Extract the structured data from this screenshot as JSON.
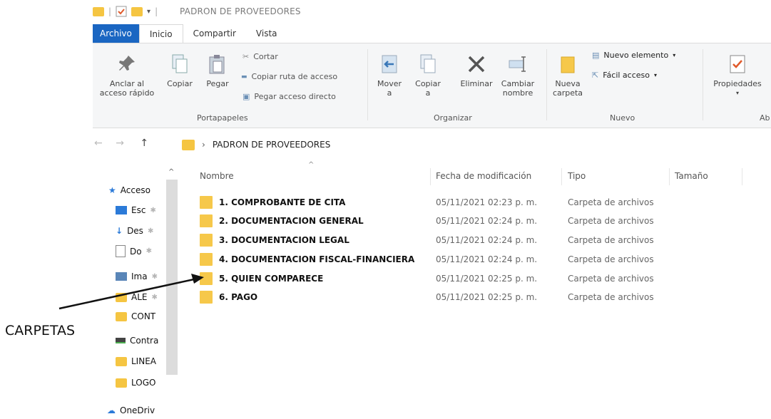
{
  "window": {
    "title": "PADRON DE PROVEEDORES"
  },
  "ribbon_tabs": [
    "Archivo",
    "Inicio",
    "Compartir",
    "Vista"
  ],
  "ribbon": {
    "anclar": "Anclar al\nacceso rápido",
    "copiar": "Copiar",
    "pegar": "Pegar",
    "cortar": "Cortar",
    "copiar_ruta": "Copiar ruta de acceso",
    "pegar_acceso": "Pegar acceso directo",
    "portapapeles": "Portapapeles",
    "mover": "Mover\na",
    "copiar_a": "Copiar\na",
    "eliminar": "Eliminar",
    "cambiar_nombre": "Cambiar\nnombre",
    "organizar": "Organizar",
    "nueva_carpeta": "Nueva\ncarpeta",
    "nuevo_elemento": "Nuevo elemento",
    "facil_acceso": "Fácil acceso",
    "nuevo": "Nuevo",
    "propiedades": "Propiedades",
    "abrir_partial": "Ab"
  },
  "address": {
    "path": "PADRON DE PROVEEDORES"
  },
  "columns": {
    "nombre": "Nombre",
    "fecha": "Fecha de modificación",
    "tipo": "Tipo",
    "tamano": "Tamaño"
  },
  "files": [
    {
      "name": "1. COMPROBANTE DE CITA",
      "date": "05/11/2021 02:23 p. m.",
      "type": "Carpeta de archivos"
    },
    {
      "name": "2. DOCUMENTACION GENERAL",
      "date": "05/11/2021 02:24 p. m.",
      "type": "Carpeta de archivos"
    },
    {
      "name": "3. DOCUMENTACION LEGAL",
      "date": "05/11/2021 02:24 p. m.",
      "type": "Carpeta de archivos"
    },
    {
      "name": "4. DOCUMENTACION FISCAL-FINANCIERA",
      "date": "05/11/2021 02:24 p. m.",
      "type": "Carpeta de archivos"
    },
    {
      "name": "5. QUIEN COMPARECE",
      "date": "05/11/2021 02:25 p. m.",
      "type": "Carpeta de archivos"
    },
    {
      "name": "6. PAGO",
      "date": "05/11/2021 02:25 p. m.",
      "type": "Carpeta de archivos"
    }
  ],
  "nav_pane": [
    {
      "label": "Acceso",
      "icon": "star-icon"
    },
    {
      "label": "Esc",
      "icon": "desktop-icon"
    },
    {
      "label": "Des",
      "icon": "download-icon"
    },
    {
      "label": "Do",
      "icon": "document-icon"
    },
    {
      "label": "Ima",
      "icon": "image-icon"
    },
    {
      "label": "ALE",
      "icon": "folder-icon"
    },
    {
      "label": "CONT",
      "icon": "folder-icon"
    },
    {
      "label": "Contra",
      "icon": "drive-icon"
    },
    {
      "label": "LINEA",
      "icon": "folder-icon"
    },
    {
      "label": "LOGO",
      "icon": "folder-icon"
    },
    {
      "label": "OneDriv",
      "icon": "cloud-icon"
    }
  ],
  "annotation": "CARPETAS",
  "colors": {
    "accent": "#1a66c2",
    "folder": "#f6c84a"
  }
}
